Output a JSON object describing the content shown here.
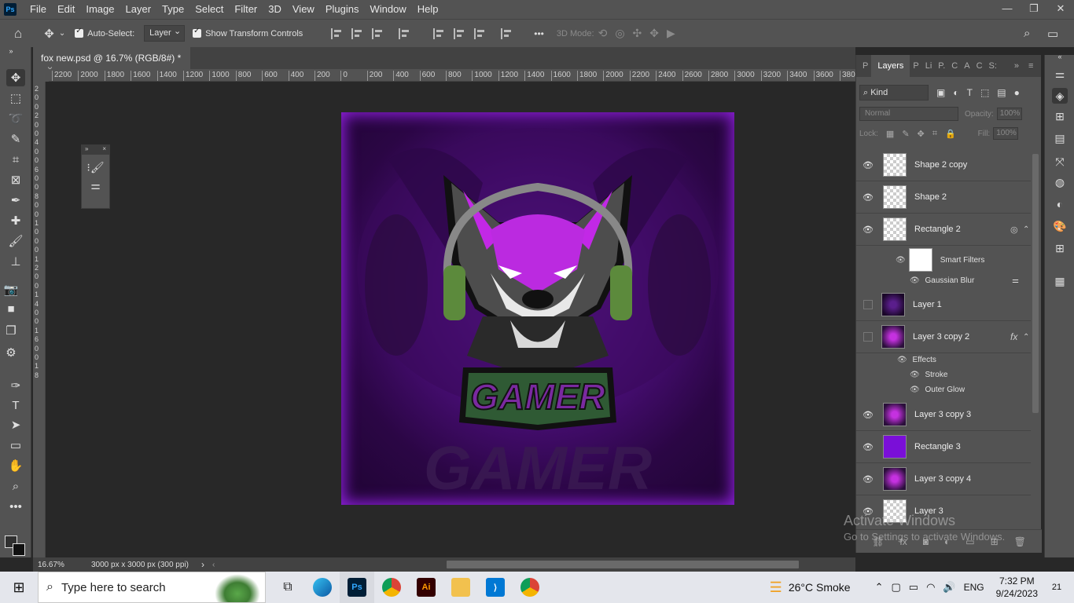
{
  "app": {
    "logo": "Ps"
  },
  "menu": [
    "File",
    "Edit",
    "Image",
    "Layer",
    "Type",
    "Select",
    "Filter",
    "3D",
    "View",
    "Plugins",
    "Window",
    "Help"
  ],
  "window_controls": {
    "minimize": "—",
    "restore": "❐",
    "close": "✕"
  },
  "options": {
    "auto_select_label": "Auto-Select:",
    "auto_select_value": "Layer",
    "show_transform_label": "Show Transform Controls",
    "more": "•••",
    "mode_3d_label": "3D Mode:"
  },
  "document": {
    "tab_title": "fox new.psd @ 16.7% (RGB/8#) *",
    "tab_close": "×"
  },
  "ruler": {
    "h_ticks": [
      "2200",
      "2000",
      "1800",
      "1600",
      "1400",
      "1200",
      "1000",
      "800",
      "600",
      "400",
      "200",
      "0",
      "200",
      "400",
      "600",
      "800",
      "1000",
      "1200",
      "1400",
      "1600",
      "1800",
      "2000",
      "2200",
      "2400",
      "2600",
      "2800",
      "3000",
      "3200",
      "3400",
      "3600",
      "380"
    ],
    "v_ticks": [
      "2",
      "0",
      "0",
      "2",
      "0",
      "0",
      "4",
      "0",
      "0",
      "6",
      "0",
      "0",
      "8",
      "0",
      "0",
      "1",
      "0",
      "0",
      "0",
      "1",
      "2",
      "0",
      "0",
      "1",
      "4",
      "0",
      "0",
      "1",
      "6",
      "0",
      "0",
      "1",
      "8"
    ]
  },
  "status": {
    "zoom": "16.67%",
    "doc_size": "3000 px x 3000 px (300 ppi)",
    "arrow": "›"
  },
  "panel": {
    "tabs": [
      "P",
      "Layers",
      "P",
      "Li",
      "P.",
      "C",
      "A",
      "C",
      "S:"
    ],
    "kind": "Kind",
    "blend_mode": "Normal",
    "opacity_label": "Opacity:",
    "opacity_value": "100%",
    "lock_label": "Lock:",
    "fill_label": "Fill:",
    "fill_value": "100%"
  },
  "layers": [
    {
      "name": "Shape 2 copy",
      "visible": true,
      "thumb": "checker"
    },
    {
      "name": "Shape 2",
      "visible": true,
      "thumb": "checker"
    },
    {
      "name": "Rectangle 2",
      "visible": true,
      "thumb": "checker"
    },
    {
      "name": "Layer 1",
      "visible": false,
      "thumb": "dark"
    },
    {
      "name": "Layer 3 copy 2",
      "visible": false,
      "thumb": "fox"
    },
    {
      "name": "Layer 3 copy 3",
      "visible": true,
      "thumb": "fox"
    },
    {
      "name": "Rectangle 3",
      "visible": true,
      "thumb": "purple"
    },
    {
      "name": "Layer 3 copy 4",
      "visible": true,
      "thumb": "fox"
    },
    {
      "name": "Layer 3",
      "visible": true,
      "thumb": "checker"
    }
  ],
  "sublayers": {
    "smart_filters": "Smart Filters",
    "gaussian_blur": "Gaussian Blur",
    "effects": "Effects",
    "stroke": "Stroke",
    "outer_glow": "Outer Glow",
    "fx": "fx"
  },
  "watermark": {
    "line1": "Activate Windows",
    "line2": "Go to Settings to activate Windows."
  },
  "taskbar": {
    "search_placeholder": "Type here to search",
    "weather": "26°C  Smoke",
    "lang": "ENG",
    "time": "7:32 PM",
    "date": "9/24/2023",
    "notifications": "21"
  },
  "colors": {
    "accent_purple": "#7a0fd8",
    "ui_dark": "#535353",
    "canvas_bg": "#282828"
  }
}
